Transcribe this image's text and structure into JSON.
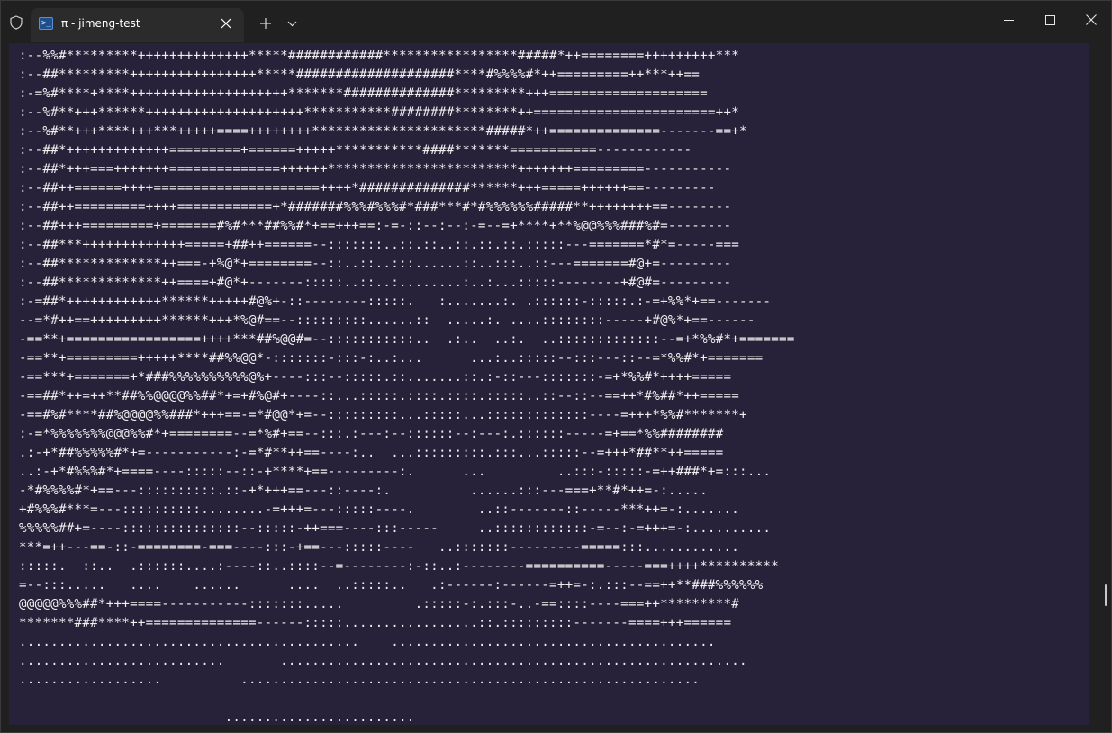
{
  "window": {
    "tab_title": "π - jimeng-test",
    "tab_icon_glyph": ">_"
  },
  "icons": {
    "shield": "shield-icon",
    "tab": "terminal-icon",
    "close_tab": "close-icon",
    "new_tab": "plus-icon",
    "dropdown": "chevron-down-icon",
    "minimize": "minimize-icon",
    "maximize": "maximize-icon",
    "close_window": "close-icon"
  },
  "colors": {
    "titlebar_bg": "#202020",
    "tab_bg": "#2b2b2b",
    "terminal_bg": "#272239",
    "terminal_fg": "#f0f0f0"
  },
  "terminal": {
    "lines": [
      ":--%%#*********++++++++++++++*****############*****************#####*++========+++++++++***",
      ":--##*********++++++++++++++++*****####################****#%%%%#*++=========++***++==",
      ":-=%#****+****++++++++++++++++++++*******##############*********+++====================",
      ":--%#**+++******++++++++++++++++++++***********########********++=======================++*",
      ":--%#**+++****+++***+++++====++++++++**********************#####*++==============-------==+*",
      ":--##*+++++++++++++=========+======+++++***********####*******===========------------",
      ":--##*+++===+++++++==============++++++************************+++++++=========-----------",
      ":--##++======++++=====================++++*##############******+++=====++++++==---------",
      ":--##++=========++++============+*#######%%%#%%%#*###***#*#%%%%%%#####**++++++++==--------",
      ":--##+++=========+=======#%#***##%%#*+==+++==:-=-::--:--:-=--=+****+**%@@%%%###%#=--------",
      ":--##***+++++++++++++=====+##++======--:::::::..::.::..::.::.::.:::::---=======*#*=-----===",
      ":--##*************++===-+%@*+========--::..::..:::......::..:::..::---=======#@+=---------",
      ":--##*************++====+#@*+-------:::::..::..:........:..:...:::::--------+#@#=---------",
      ":-=##*++++++++++++******+++++#@%+-::--------:::::.   :.......:. .::::::-:::::.:-=+%%*+==-------",
      "--=*#++==+++++++++******+++*%@#==--:::::::::......::  .....:. ....::::::::-----+#@%*+==------",
      "-==**+=================++++***##%@@#=--:::::::::::..  .:..  ..:.  ..:::::::::::::--=+*%%#*+=======",
      "-==**+=========+++++****##%%@@*-:::::::-:::-:..:...      ...:..:::::--:::---::--=*%%#*+=======",
      "-==***+=======+*###%%%%%%%%%%@%+----:::--:::::.::.......::.:-::---:::::::-=+*%%#*++++=====",
      "-==##*++=++**##%%@@@@%%##*+=+#%@#+----::...:::::.::::.::::.:::::..::--::--==++*#%##*++=====",
      "-==#%#****##%@@@@%%###*+++==-=*#@@*+=--:::::::::...:::::...:::::::::::::----=+++*%%#*******+",
      ":-=*%%%%%%%@@@%%#*+========--=*%#+==--:::.:---:--::::::--:---:.::::::-----=+==*%%########",
      ".:-+*##%%%%%#*+=-----------:-=*#**++==----:..  ...:::::::::.:::...:::::--=+++*##**++=====",
      "..:-+*#%%%#*+====----:::::--::-+****+==---------:.      ...         ..:::-:::::-=++###*+=:::...",
      "-*#%%%%#*+==---::::::::::.::-+*+++==---::----:.          ......:::---===+**#*++=-:.....",
      "+#%%%#***=---::::::::::........-=+++=---:::::----.        ..::-------::-----***++=-:.......",
      "%%%%%##+=----:::::::::::::::--:::::-++===----:::-----     ..::::::::::::-=--:-=+++=-:..........",
      "***=++---==-::-========-===----:::-+==---:::::----   ..:::::::---------=====:::............",
      ":::::.  ::..  .::::::....:----::..::::--=--------:-::..:--------==========-----===++++**********",
      "=--:::.....   ....    ......      ....  ..:::::..   .:------:------=++=-:.:::--==++**###%%%%%%",
      "@@@@@%%%##*+++====-----------:::::::.....         .:::::-:.:::-..-==::::----===++*********#",
      "*******###****++==============------:::::.................::.:::::::::-------====+++======",
      "...........................................    .........................................",
      "..........................       ...........................................................",
      "..................          ..........................................................",
      "",
      "                          ........................"
    ]
  }
}
